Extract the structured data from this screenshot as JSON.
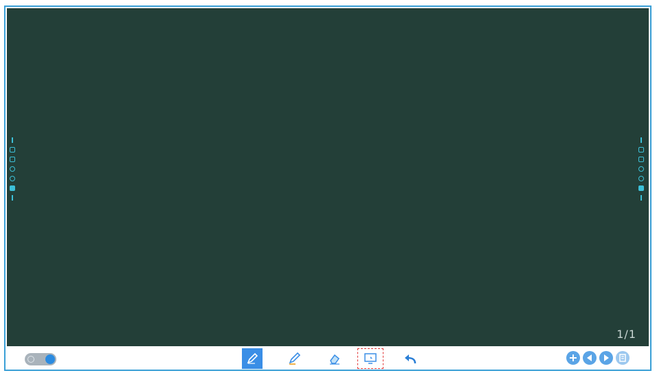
{
  "board": {
    "background_color": "#233f38",
    "page_indicator": "1/1"
  },
  "side_tools": {
    "icons": [
      "menu-icon",
      "image-icon",
      "share-icon",
      "settings-icon",
      "home-icon",
      "camera-icon",
      "menu-icon"
    ]
  },
  "toolbar": {
    "toggle_state": "on",
    "tools": [
      {
        "name": "pen-tool",
        "icon": "pen-icon",
        "active": true
      },
      {
        "name": "highlighter-tool",
        "icon": "highlighter-icon",
        "active": false
      },
      {
        "name": "eraser-tool",
        "icon": "eraser-icon",
        "active": false
      },
      {
        "name": "screen-tool",
        "icon": "screen-icon",
        "active": false
      },
      {
        "name": "undo-tool",
        "icon": "undo-icon",
        "active": false
      }
    ],
    "page_nav": [
      "add-page-icon",
      "prev-page-icon",
      "next-page-icon",
      "page-list-icon"
    ]
  },
  "colors": {
    "frame_border": "#3a9fd6",
    "accent": "#3a8ee6",
    "side_icon": "#3cc0d8",
    "highlight_box": "#e23b3b"
  }
}
